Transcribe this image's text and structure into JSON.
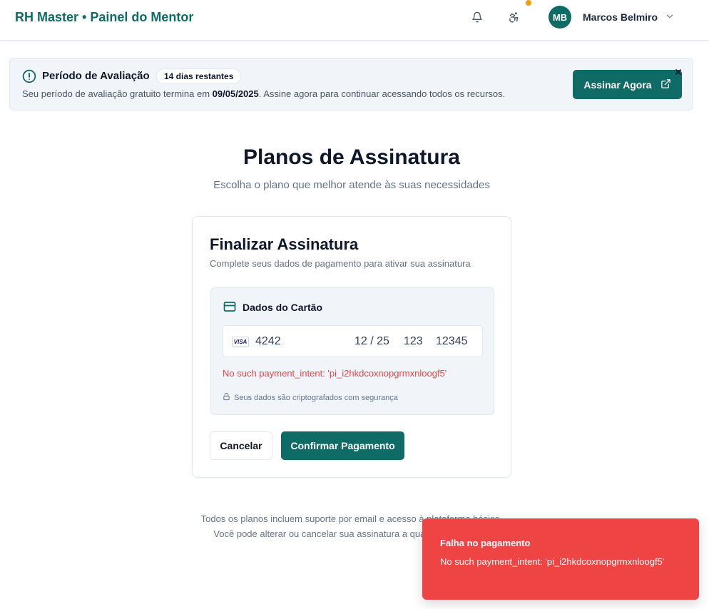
{
  "header": {
    "title": "RH Master • Painel do Mentor",
    "user": {
      "initials": "MB",
      "name": "Marcos Belmiro"
    },
    "colors": {
      "brand": "#0f6b66",
      "notification_dot": "#f59e0b"
    },
    "icons": [
      "bell-icon",
      "accessibility-icon",
      "chevron-down-icon"
    ]
  },
  "trial": {
    "title": "Período de Avaliação",
    "badge": "14 dias restantes",
    "text_prefix": "Seu período de avaliação gratuito termina em ",
    "date": "09/05/2025",
    "text_suffix": ". Assine agora para continuar acessando todos os recursos.",
    "button_label": "Assinar Agora"
  },
  "main": {
    "title": "Planos de Assinatura",
    "subtitle": "Escolha o plano que melhor atende às suas necessidades"
  },
  "checkout": {
    "title": "Finalizar Assinatura",
    "subtitle": "Complete seus dados de pagamento para ativar sua assinatura",
    "section_title": "Dados do Cartão",
    "card_brand": "VISA",
    "card_number": "4242",
    "expiry": "12 / 25",
    "cvc": "123",
    "zip": "12345",
    "error": "No such payment_intent: 'pi_i2hkdcoxnopgrmxnloogf5'",
    "secure_note": "Seus dados são criptografados com segurança",
    "cancel_label": "Cancelar",
    "confirm_label": "Confirmar Pagamento"
  },
  "footer": {
    "line1": "Todos os planos incluem suporte por email e acesso à plataforma básica.",
    "line2": "Você pode alterar ou cancelar sua assinatura a qualquer momento."
  },
  "toast": {
    "title": "Falha no pagamento",
    "message": "No such payment_intent: 'pi_i2hkdcoxnopgrmxnloogf5'",
    "color": "#ef4444"
  }
}
